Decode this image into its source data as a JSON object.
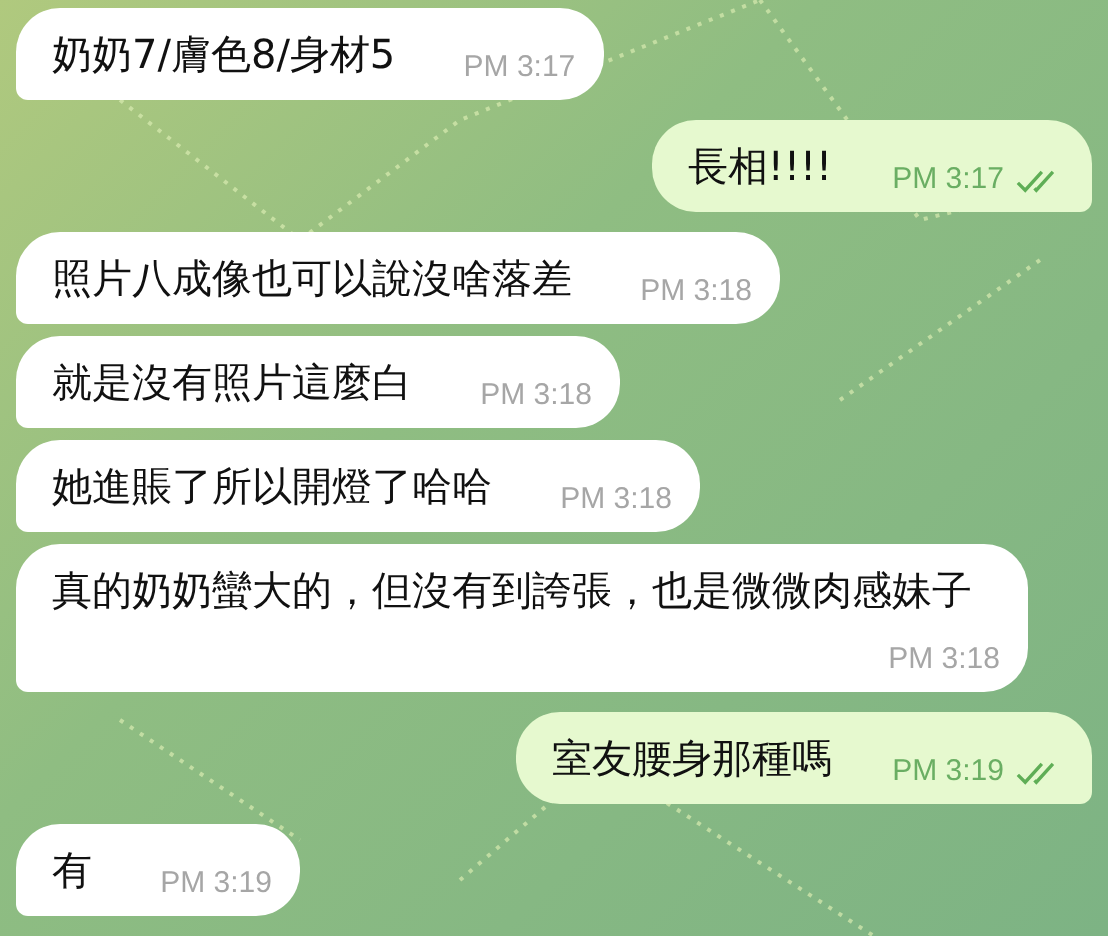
{
  "messages": [
    {
      "kind": "incoming",
      "text": "奶奶7/膚色8/身材5",
      "time": "PM 3:17"
    },
    {
      "kind": "outgoing",
      "text": "長相!!!!",
      "time": "PM 3:17",
      "read": true
    },
    {
      "kind": "incoming",
      "text": "照片八成像也可以說沒啥落差",
      "time": "PM 3:18"
    },
    {
      "kind": "incoming",
      "text": "就是沒有照片這麼白",
      "time": "PM 3:18"
    },
    {
      "kind": "incoming",
      "text": "她進賬了所以開燈了哈哈",
      "time": "PM 3:18"
    },
    {
      "kind": "incoming",
      "text": "真的奶奶蠻大的，但沒有到誇張，也是微微肉感妹子",
      "time": "PM 3:18"
    },
    {
      "kind": "outgoing",
      "text": "室友腰身那種嗎",
      "time": "PM 3:19",
      "read": true
    },
    {
      "kind": "incoming",
      "text": "有",
      "time": "PM 3:19"
    }
  ]
}
